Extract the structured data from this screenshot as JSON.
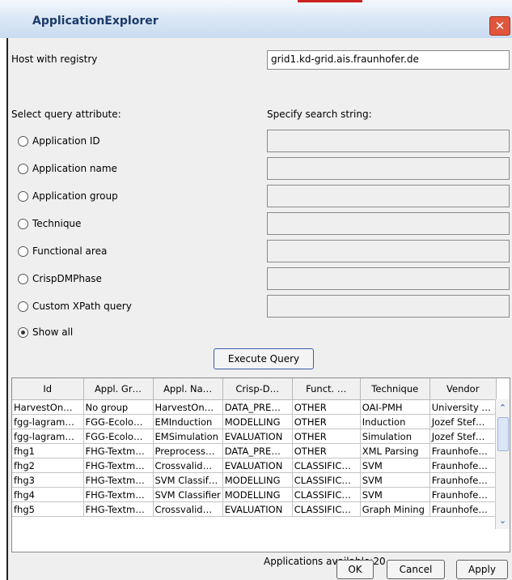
{
  "window": {
    "title": "ApplicationExplorer",
    "close_glyph": "✕"
  },
  "host": {
    "label": "Host with registry",
    "value": "grid1.kd-grid.ais.fraunhofer.de"
  },
  "query": {
    "attribute_label": "Select query attribute:",
    "search_label": "Specify search string:",
    "options": [
      {
        "label": "Application ID",
        "selected": false
      },
      {
        "label": "Application name",
        "selected": false
      },
      {
        "label": "Application group",
        "selected": false
      },
      {
        "label": "Technique",
        "selected": false
      },
      {
        "label": "Functional area",
        "selected": false
      },
      {
        "label": "CrispDMPhase",
        "selected": false
      },
      {
        "label": "Custom XPath query",
        "selected": false
      },
      {
        "label": "Show all",
        "selected": true
      }
    ],
    "execute_label": "Execute Query"
  },
  "table": {
    "columns": [
      "Id",
      "Appl. Gr…",
      "Appl. Na…",
      "Crisp-D…",
      "Funct. …",
      "Technique",
      "Vendor"
    ],
    "rows": [
      [
        "HarvestOn…",
        "No group",
        "HarvestOn…",
        "DATA_PRE…",
        "OTHER",
        "OAI-PMH",
        "University …"
      ],
      [
        "fgg-lagram…",
        "FGG-Ecolo…",
        "EMInduction",
        "MODELLING",
        "OTHER",
        "Induction",
        "Jozef Stef…"
      ],
      [
        "fgg-lagram…",
        "FGG-Ecolo…",
        "EMSimulation",
        "EVALUATION",
        "OTHER",
        "Simulation",
        "Jozef Stef…"
      ],
      [
        "fhg1",
        "FHG-Textm…",
        "Preprocess…",
        "DATA_PRE…",
        "OTHER",
        "XML Parsing",
        "Fraunhofe…"
      ],
      [
        "fhg2",
        "FHG-Textm…",
        "Crossvalid…",
        "EVALUATION",
        "CLASSIFIC…",
        "SVM",
        "Fraunhofe…"
      ],
      [
        "fhg3",
        "FHG-Textm…",
        "SVM Classif…",
        "MODELLING",
        "CLASSIFIC…",
        "SVM",
        "Fraunhofe…"
      ],
      [
        "fhg4",
        "FHG-Textm…",
        "SVM Classifier",
        "MODELLING",
        "CLASSIFIC…",
        "SVM",
        "Fraunhofe…"
      ],
      [
        "fhg5",
        "FHG-Textm…",
        "Crossvalid…",
        "EVALUATION",
        "CLASSIFIC…",
        "Graph Mining",
        "Fraunhofe…"
      ]
    ],
    "scroll_up_glyph": "⌃",
    "scroll_down_glyph": "⌄"
  },
  "status": {
    "text": "Applications available:20"
  },
  "buttons": {
    "ok": "OK",
    "cancel": "Cancel",
    "apply": "Apply"
  }
}
